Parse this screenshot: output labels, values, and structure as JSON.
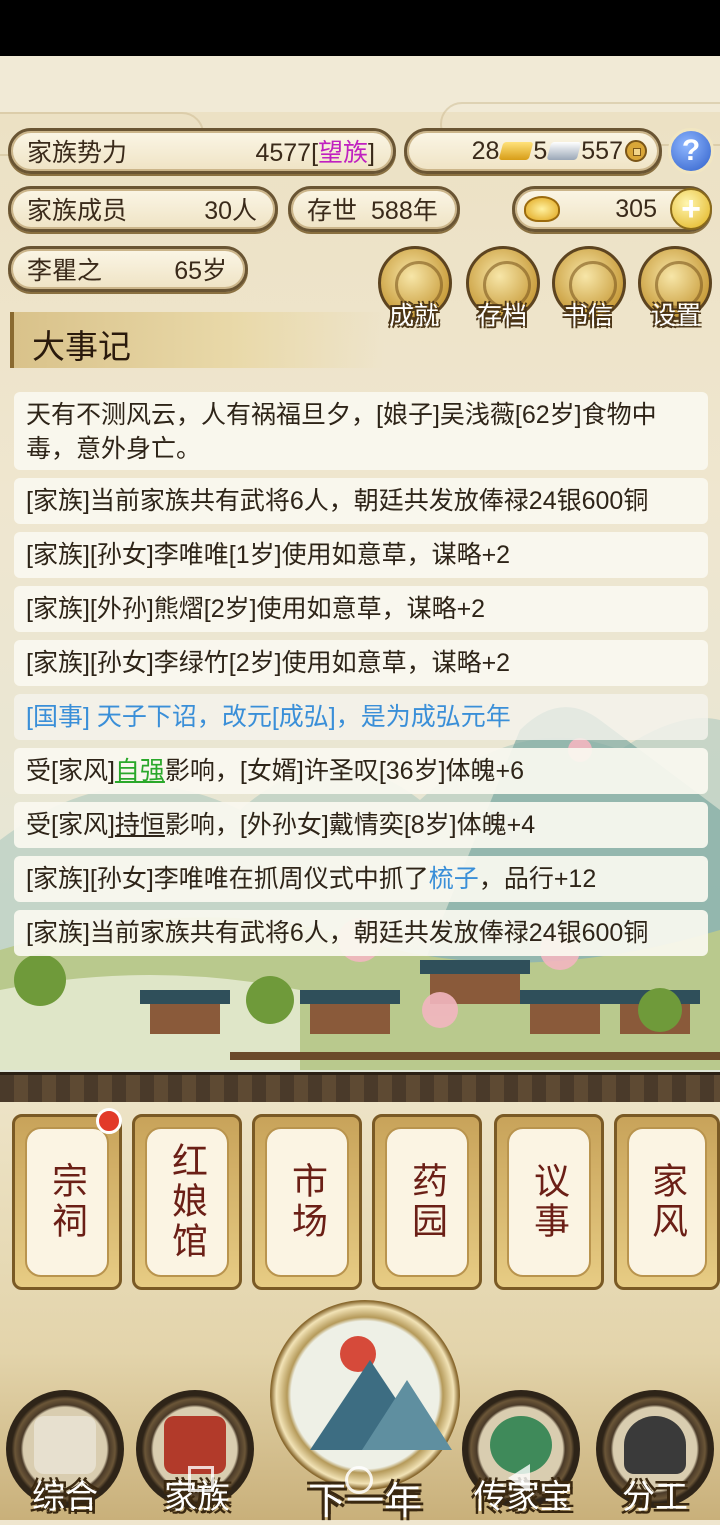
{
  "stats": {
    "influence_label": "家族势力",
    "influence_value": "4577",
    "rank_open": "[",
    "rank": "望族",
    "rank_close": "]",
    "gold": "28",
    "silver": "5",
    "copper": "557",
    "members_label": "家族成员",
    "members_value": "30人",
    "existence_label": "存世",
    "existence_value": "588年",
    "ingot_value": "305",
    "patriarch_name": "李瞿之",
    "patriarch_age": "65岁"
  },
  "menu": {
    "achievements": "成就",
    "save": "存档",
    "letters": "书信",
    "settings": "设置"
  },
  "chronicle": {
    "title": "大事记",
    "entries": [
      {
        "text": "天有不测风云，人有祸福旦夕，[娘子]吴浅薇[62岁]食物中毒，意外身亡。"
      },
      {
        "text": "[家族]当前家族共有武将6人，朝廷共发放俸禄24银600铜"
      },
      {
        "text": "[家族][孙女]李唯唯[1岁]使用如意草，谋略+2"
      },
      {
        "text": "[家族][外孙]熊熠[2岁]使用如意草，谋略+2"
      },
      {
        "text": "[家族][孙女]李绿竹[2岁]使用如意草，谋略+2"
      },
      {
        "text": "[国事] 天子下诏，改元[成弘]，是为成弘元年"
      },
      {
        "pre": "受[家风]",
        "hl": "自强",
        "post": "影响，[女婿]许圣叹[36岁]体魄+6"
      },
      {
        "pre": "受[家风]",
        "hl": "持恒",
        "post": "影响，[外孙女]戴情奕[8岁]体魄+4"
      },
      {
        "pre": "[家族][孙女]李唯唯在抓周仪式中抓了",
        "hl": "梳子",
        "post": "，品行+12"
      },
      {
        "text": "[家族]当前家族共有武将6人，朝廷共发放俸禄24银600铜"
      }
    ]
  },
  "cards": [
    "宗祠",
    "红娘馆",
    "市场",
    "药园",
    "议事",
    "家风"
  ],
  "nav": {
    "general": "综合",
    "family": "家族",
    "next_year": "下一年",
    "heirloom": "传家宝",
    "division": "分工"
  },
  "colors": {
    "rank": "#c020c0",
    "green_highlight": "#2aa82a",
    "blue_text": "#3a8fd8",
    "card_text": "#6b1f16"
  }
}
